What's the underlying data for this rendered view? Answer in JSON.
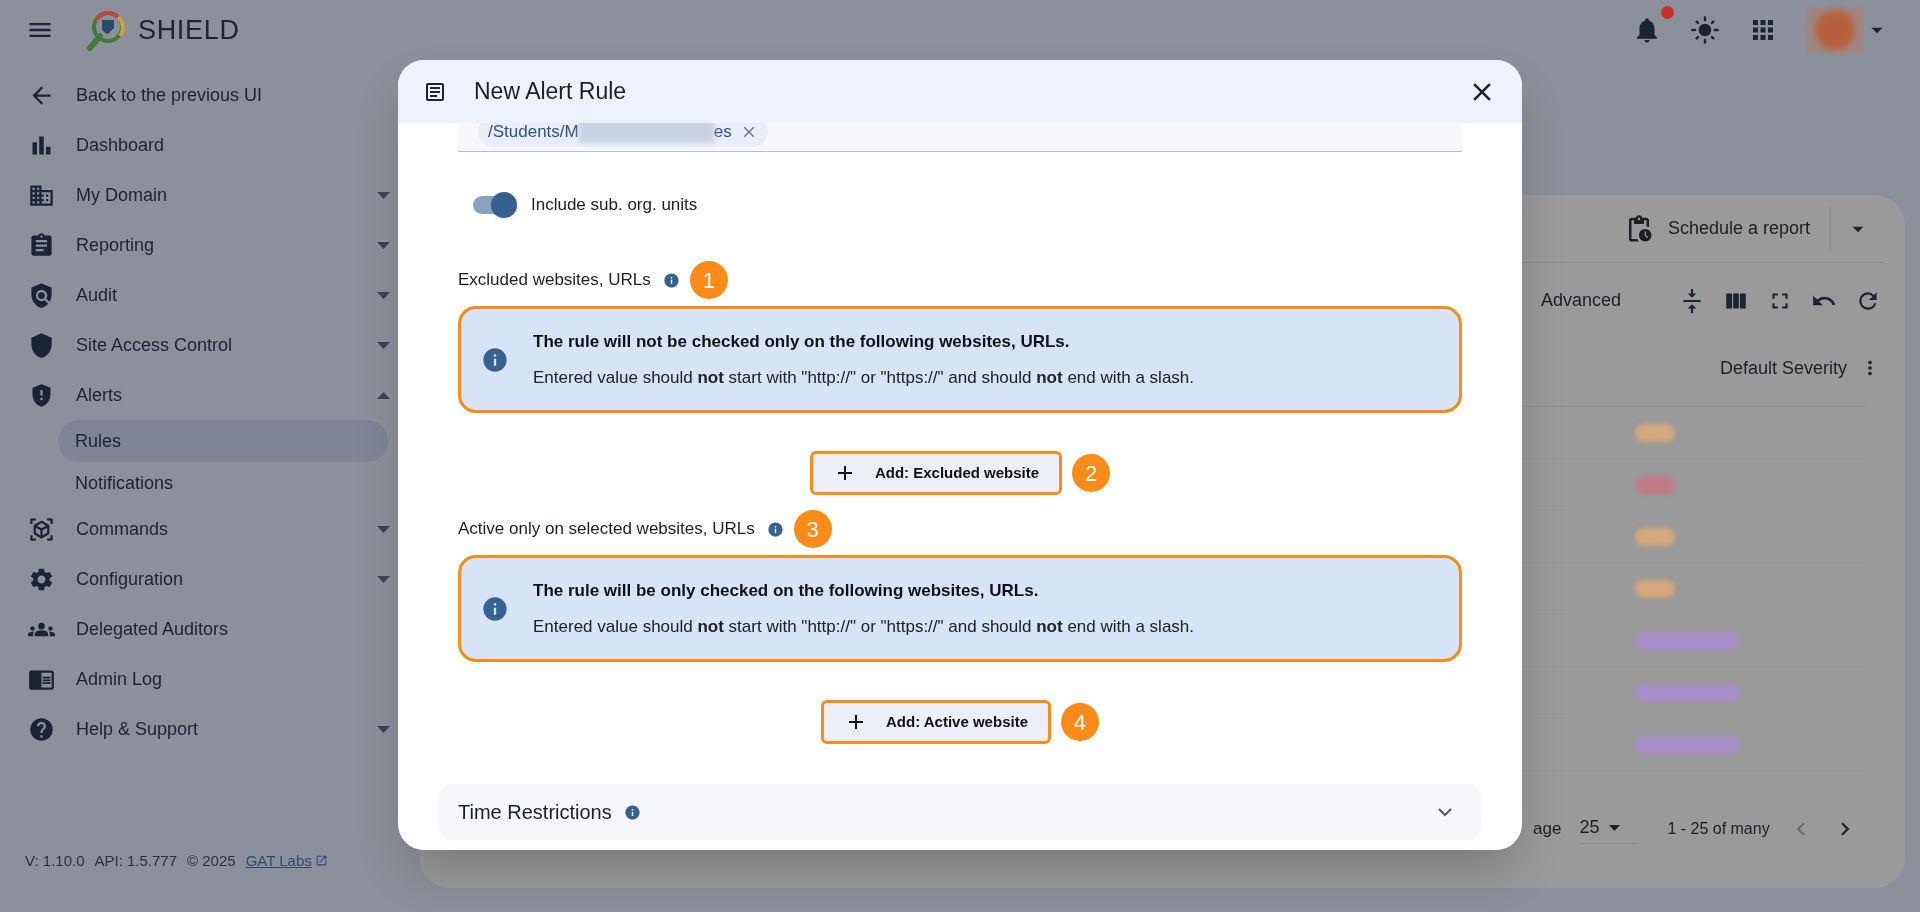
{
  "app": {
    "title": "SHIELD"
  },
  "sidebar": {
    "items": [
      {
        "label": "Back to the previous UI",
        "selected": false
      },
      {
        "label": "Dashboard",
        "selected": false
      },
      {
        "label": "My Domain",
        "selected": false,
        "expanded": false
      },
      {
        "label": "Reporting",
        "selected": false,
        "expanded": false
      },
      {
        "label": "Audit",
        "selected": false,
        "expanded": false
      },
      {
        "label": "Site Access Control",
        "selected": false,
        "expanded": false
      },
      {
        "label": "Alerts",
        "selected": false,
        "expanded": true,
        "children": [
          {
            "label": "Rules",
            "selected": true
          },
          {
            "label": "Notifications",
            "selected": false
          }
        ]
      },
      {
        "label": "Commands",
        "selected": false,
        "expanded": false
      },
      {
        "label": "Configuration",
        "selected": false,
        "expanded": false
      },
      {
        "label": "Delegated Auditors",
        "selected": false
      },
      {
        "label": "Admin Log",
        "selected": false
      },
      {
        "label": "Help & Support",
        "selected": false,
        "expanded": false
      }
    ],
    "footer": {
      "version": "V: 1.10.0",
      "api": "API: 1.5.777",
      "copyright": "© 2025",
      "link": "GAT Labs"
    }
  },
  "top_bar": {
    "notifications_unread": true
  },
  "report_panel": {
    "schedule_button": "Schedule a report",
    "filter_label": "Advanced",
    "column_header": "Default Severity",
    "rows": [
      {
        "color": "#d4a77c"
      },
      {
        "color": "#c27a86"
      },
      {
        "color": "#d4a77c"
      },
      {
        "color": "#d4a77c"
      },
      {
        "color": "#a68dc6"
      },
      {
        "color": "#a68dc6"
      },
      {
        "color": "#a68dc6"
      }
    ],
    "pagination": {
      "rows_label": "age",
      "rows_value": "25",
      "range": "1 - 25 of many"
    }
  },
  "dialog": {
    "title": "New Alert Rule",
    "org_unit_chip": {
      "start": "/Students/M",
      "end": "es"
    },
    "include_sub_units": {
      "label": "Include sub. org. units",
      "on": true
    },
    "sections": [
      {
        "label": "Excluded websites, URLs",
        "marker": "1",
        "info": {
          "title": "The rule will not be checked only on the following websites, URLs.",
          "note": "Entered value should **not** start with \"http://\" or \"https://\" and should **not** end with a slash.",
          "highlighted": true
        },
        "button": {
          "label": "Add: Excluded website",
          "marker": "2",
          "highlighted": true
        }
      },
      {
        "label": "Active only on selected websites, URLs",
        "marker": "3",
        "info": {
          "title": "The rule will be only checked on the following websites, URLs.",
          "note": "Entered value should **not** start with \"http://\" or \"https://\" and should **not** end with a slash.",
          "highlighted": true
        },
        "button": {
          "label": "Add: Active website",
          "marker": "4",
          "highlighted": true
        }
      }
    ],
    "time_restrictions": {
      "label": "Time Restrictions",
      "expanded": false
    }
  }
}
